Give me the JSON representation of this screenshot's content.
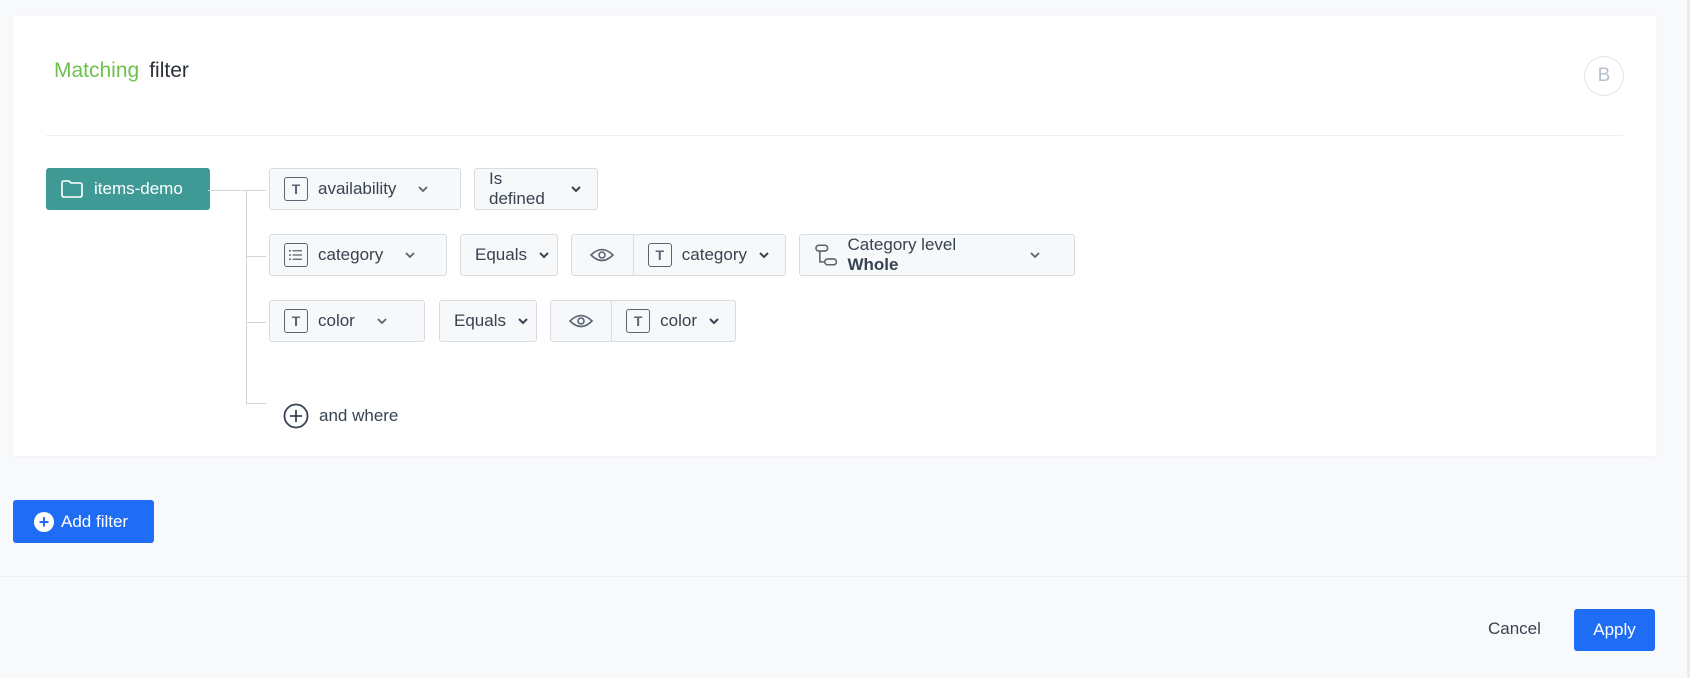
{
  "header": {
    "title_part1": "Matching",
    "title_part2": "filter",
    "badge": "B"
  },
  "source": {
    "label": "items-demo",
    "icon": "folder-icon"
  },
  "conditions": [
    {
      "attribute": "availability",
      "attribute_icon": "text-type-icon",
      "operator": "Is defined"
    },
    {
      "attribute": "category",
      "attribute_icon": "list-type-icon",
      "operator": "Equals",
      "value_icon": "eye-icon",
      "value": "category",
      "extra_label": "Category level",
      "extra_value": "Whole"
    },
    {
      "attribute": "color",
      "attribute_icon": "text-type-icon",
      "operator": "Equals",
      "value_icon": "eye-icon",
      "value": "color"
    }
  ],
  "and_where": "and where",
  "add_filter": "Add filter",
  "footer": {
    "cancel": "Cancel",
    "apply": "Apply"
  },
  "colors": {
    "accent": "#6cc24a",
    "source_bg": "#3f9a96",
    "primary": "#1f6cf5"
  }
}
